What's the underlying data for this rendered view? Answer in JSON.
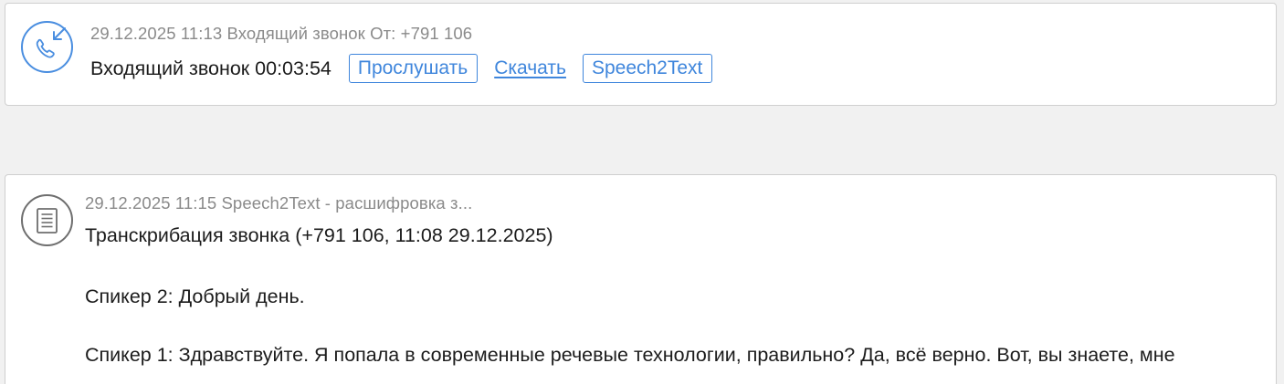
{
  "call_event": {
    "meta_text": "29.12.2025 11:13 Входящий звонок От: +791          106",
    "title": "Входящий звонок 00:03:54",
    "listen_label": "Прослушать",
    "download_label": "Скачать",
    "speech2text_label": "Speech2Text",
    "icon": "incoming-call-icon"
  },
  "transcript_event": {
    "meta_text": "29.12.2025 11:15 Speech2Text - расшифровка з...",
    "title": "Транскрибация звонка (+791           106, 11:08 29.12.2025)",
    "lines": [
      "Спикер 2: Добрый день.",
      "Спикер 1: Здравствуйте. Я попала в современные речевые технологии, правильно? Да, всё верно. Вот, вы знаете, мне"
    ],
    "icon": "document-icon"
  },
  "colors": {
    "accent": "#3f86dc",
    "meta_text": "#8a8a8a",
    "body_text": "#1c1c1c",
    "background": "#f1f1f1"
  }
}
